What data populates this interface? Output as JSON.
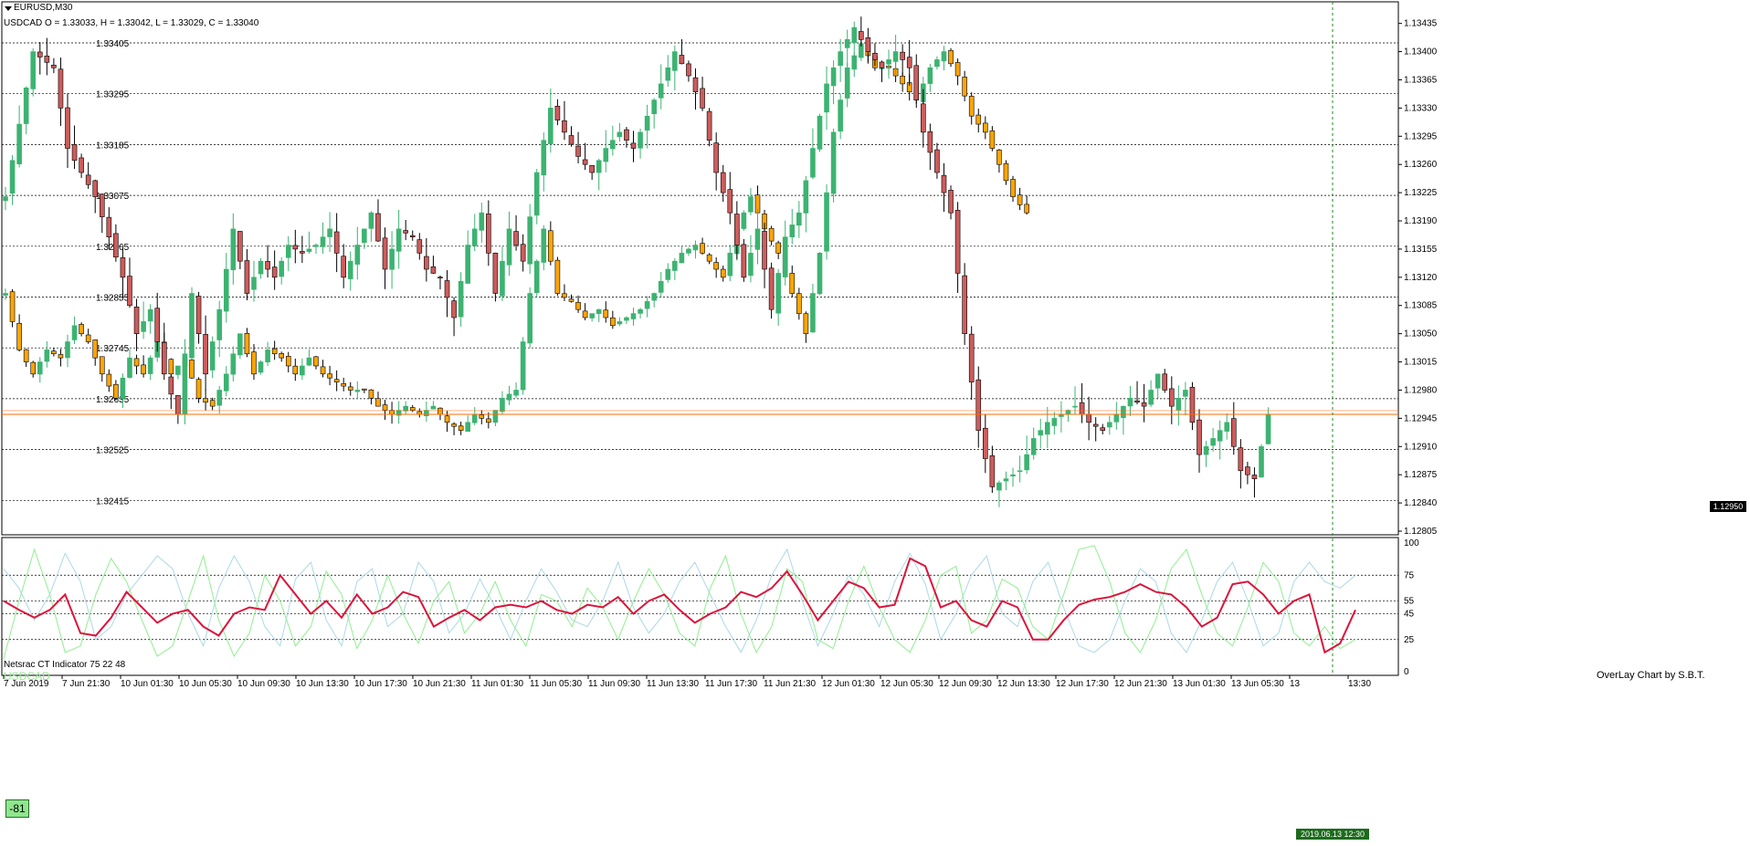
{
  "window": {
    "symbol_title": "EURUSD,M30",
    "overlay_info": "USDCAD O = 1.33033, H = 1.33042, L = 1.33029, C = 1.33040",
    "credit": "OverLay Chart by S.B.T.",
    "indicator_title": "Netsrac CT Indicator 75 22 48",
    "indicator_symbol": "USDCAD",
    "gauge_value": "-81",
    "current_price": "1.12950",
    "cursor_time": "2019.06.13 12:30"
  },
  "colors": {
    "bull": "#3cb371",
    "bear_body": "#cd5c5c",
    "overlay": "#ffa500",
    "grid": "#000000",
    "price_line": "#ff6a00",
    "cursor": "#228b22",
    "ct_line": "#dc143c",
    "green_line": "#90ee90",
    "blue_line": "#add8e6"
  },
  "chart_data": [
    {
      "type": "candlestick",
      "name": "EURUSD,M30",
      "right_axis_ticks": [
        "1.13435",
        "1.13400",
        "1.13365",
        "1.13330",
        "1.13295",
        "1.13260",
        "1.13225",
        "1.13190",
        "1.13155",
        "1.13120",
        "1.13085",
        "1.13050",
        "1.13015",
        "1.12980",
        "1.12945",
        "1.12910",
        "1.12875",
        "1.12840",
        "1.12805"
      ],
      "left_overlay_ticks": [
        "1.33405",
        "1.33295",
        "1.33185",
        "1.33075",
        "1.32965",
        "1.32855",
        "1.32745",
        "1.32635",
        "1.32525",
        "1.32415"
      ],
      "x_ticks": [
        "7 Jun 2019",
        "7 Jun 21:30",
        "10 Jun 01:30",
        "10 Jun 05:30",
        "10 Jun 09:30",
        "10 Jun 13:30",
        "10 Jun 17:30",
        "10 Jun 21:30",
        "11 Jun 01:30",
        "11 Jun 05:30",
        "11 Jun 09:30",
        "11 Jun 13:30",
        "11 Jun 17:30",
        "11 Jun 21:30",
        "12 Jun 01:30",
        "12 Jun 05:30",
        "12 Jun 09:30",
        "12 Jun 13:30",
        "12 Jun 17:30",
        "12 Jun 21:30",
        "13 Jun 01:30",
        "13 Jun 05:30",
        "13",
        "13:30"
      ],
      "ylim": [
        1.12805,
        1.13455
      ],
      "current_price": 1.1295,
      "close_path": [
        [
          0,
          1.1322
        ],
        [
          4,
          1.134
        ],
        [
          7,
          1.1338
        ],
        [
          9,
          1.1328
        ],
        [
          11,
          1.1325
        ],
        [
          13,
          1.1322
        ],
        [
          15,
          1.1317
        ],
        [
          17,
          1.1312
        ],
        [
          19,
          1.1305
        ],
        [
          21,
          1.1308
        ],
        [
          23,
          1.13
        ],
        [
          25,
          1.1295
        ],
        [
          27,
          1.131
        ],
        [
          29,
          1.13
        ],
        [
          31,
          1.1308
        ],
        [
          33,
          1.1318
        ],
        [
          35,
          1.131
        ],
        [
          37,
          1.1314
        ],
        [
          39,
          1.1312
        ],
        [
          41,
          1.1316
        ],
        [
          43,
          1.1315
        ],
        [
          45,
          1.1316
        ],
        [
          47,
          1.1318
        ],
        [
          49,
          1.1312
        ],
        [
          51,
          1.1316
        ],
        [
          53,
          1.132
        ],
        [
          55,
          1.1313
        ],
        [
          57,
          1.1318
        ],
        [
          59,
          1.1317
        ],
        [
          61,
          1.1313
        ],
        [
          63,
          1.1312
        ],
        [
          65,
          1.1307
        ],
        [
          67,
          1.1316
        ],
        [
          69,
          1.132
        ],
        [
          71,
          1.131
        ],
        [
          73,
          1.1318
        ],
        [
          75,
          1.1314
        ],
        [
          77,
          1.1325
        ],
        [
          79,
          1.1333
        ],
        [
          81,
          1.133
        ],
        [
          83,
          1.1327
        ],
        [
          85,
          1.1325
        ],
        [
          87,
          1.1328
        ],
        [
          89,
          1.133
        ],
        [
          91,
          1.1328
        ],
        [
          93,
          1.1332
        ],
        [
          95,
          1.1336
        ],
        [
          97,
          1.134
        ],
        [
          99,
          1.1337
        ],
        [
          101,
          1.1333
        ],
        [
          103,
          1.1325
        ],
        [
          105,
          1.132
        ],
        [
          107,
          1.1312
        ],
        [
          109,
          1.1318
        ],
        [
          111,
          1.1308
        ],
        [
          113,
          1.1317
        ],
        [
          115,
          1.132
        ],
        [
          117,
          1.1328
        ],
        [
          119,
          1.1336
        ],
        [
          121,
          1.134
        ],
        [
          123,
          1.1343
        ],
        [
          125,
          1.134
        ],
        [
          127,
          1.1338
        ],
        [
          129,
          1.134
        ],
        [
          131,
          1.1338
        ],
        [
          133,
          1.133
        ],
        [
          135,
          1.1325
        ],
        [
          137,
          1.132
        ],
        [
          139,
          1.1305
        ],
        [
          141,
          1.1293
        ],
        [
          143,
          1.1286
        ],
        [
          145,
          1.1287
        ],
        [
          147,
          1.1288
        ],
        [
          149,
          1.1292
        ],
        [
          151,
          1.1294
        ],
        [
          153,
          1.1295
        ],
        [
          155,
          1.1296
        ],
        [
          157,
          1.1294
        ],
        [
          159,
          1.1293
        ],
        [
          161,
          1.1295
        ],
        [
          163,
          1.1297
        ],
        [
          165,
          1.1296
        ],
        [
          167,
          1.13
        ],
        [
          169,
          1.1296
        ],
        [
          171,
          1.1298
        ],
        [
          173,
          1.129
        ],
        [
          175,
          1.1292
        ],
        [
          177,
          1.1294
        ],
        [
          179,
          1.1288
        ],
        [
          181,
          1.1287
        ],
        [
          183,
          1.1295
        ]
      ],
      "overlay_path": [
        [
          0,
          1.131
        ],
        [
          2,
          1.1303
        ],
        [
          4,
          1.13
        ],
        [
          6,
          1.1303
        ],
        [
          8,
          1.1302
        ],
        [
          10,
          1.1306
        ],
        [
          12,
          1.1304
        ],
        [
          14,
          1.13
        ],
        [
          16,
          1.1297
        ],
        [
          18,
          1.1302
        ],
        [
          20,
          1.13
        ],
        [
          22,
          1.1304
        ],
        [
          24,
          1.13
        ],
        [
          26,
          1.1302
        ],
        [
          28,
          1.1297
        ],
        [
          30,
          1.1296
        ],
        [
          32,
          1.13
        ],
        [
          34,
          1.1305
        ],
        [
          36,
          1.13
        ],
        [
          38,
          1.1303
        ],
        [
          40,
          1.1302
        ],
        [
          42,
          1.13
        ],
        [
          44,
          1.1302
        ],
        [
          46,
          1.13
        ],
        [
          48,
          1.1299
        ],
        [
          50,
          1.1298
        ],
        [
          52,
          1.1298
        ],
        [
          54,
          1.1296
        ],
        [
          56,
          1.1295
        ],
        [
          58,
          1.1296
        ],
        [
          60,
          1.1295
        ],
        [
          62,
          1.1296
        ],
        [
          64,
          1.1294
        ],
        [
          66,
          1.1293
        ],
        [
          68,
          1.1295
        ],
        [
          70,
          1.1294
        ],
        [
          72,
          1.1297
        ],
        [
          74,
          1.1298
        ],
        [
          76,
          1.131
        ],
        [
          78,
          1.1318
        ],
        [
          80,
          1.131
        ],
        [
          82,
          1.1309
        ],
        [
          84,
          1.1307
        ],
        [
          86,
          1.1308
        ],
        [
          88,
          1.1306
        ],
        [
          90,
          1.1307
        ],
        [
          92,
          1.1308
        ],
        [
          94,
          1.131
        ],
        [
          96,
          1.1313
        ],
        [
          98,
          1.1315
        ],
        [
          100,
          1.1316
        ],
        [
          102,
          1.1314
        ],
        [
          104,
          1.1312
        ],
        [
          106,
          1.1318
        ],
        [
          108,
          1.1322
        ],
        [
          110,
          1.1318
        ],
        [
          112,
          1.1315
        ],
        [
          114,
          1.131
        ],
        [
          116,
          1.1305
        ],
        [
          118,
          1.1315
        ],
        [
          120,
          1.133
        ],
        [
          122,
          1.1338
        ],
        [
          124,
          1.1341
        ],
        [
          126,
          1.1338
        ],
        [
          128,
          1.1338
        ],
        [
          130,
          1.1336
        ],
        [
          132,
          1.1334
        ],
        [
          134,
          1.1338
        ],
        [
          136,
          1.134
        ],
        [
          138,
          1.1337
        ],
        [
          140,
          1.1332
        ],
        [
          142,
          1.133
        ],
        [
          144,
          1.1326
        ],
        [
          146,
          1.1322
        ],
        [
          148,
          1.132
        ]
      ],
      "x_range": [
        0,
        200
      ]
    },
    {
      "type": "line",
      "name": "Netsrac CT Indicator 75 22 48",
      "right_axis_ticks": [
        "100",
        "75",
        "55",
        "45",
        "25",
        "0"
      ],
      "ylim": [
        0,
        100
      ],
      "levels": [
        75,
        55,
        45,
        25
      ],
      "series": [
        {
          "name": "USDCAD",
          "values": [
            55,
            48,
            42,
            48,
            60,
            30,
            28,
            42,
            62,
            50,
            38,
            45,
            48,
            35,
            28,
            45,
            50,
            48,
            75,
            60,
            45,
            55,
            42,
            60,
            45,
            50,
            62,
            58,
            35,
            42,
            48,
            40,
            50,
            52,
            50,
            55,
            48,
            45,
            52,
            50,
            58,
            45,
            55,
            60,
            48,
            38,
            45,
            50,
            62,
            58,
            65,
            78,
            60,
            40,
            55,
            70,
            65,
            50,
            52,
            88,
            82,
            50,
            55,
            40,
            35,
            55,
            50,
            25,
            25,
            40,
            52,
            56,
            58,
            62,
            68,
            62,
            60,
            50,
            35,
            42,
            68,
            70,
            60,
            45,
            55,
            60,
            15,
            22,
            48
          ]
        },
        {
          "name": "",
          "values": [
            10,
            55,
            95,
            60,
            15,
            20,
            60,
            88,
            70,
            40,
            12,
            20,
            55,
            90,
            40,
            12,
            30,
            75,
            55,
            20,
            35,
            78,
            60,
            18,
            40,
            75,
            45,
            22,
            55,
            70,
            30,
            45,
            70,
            40,
            20,
            60,
            55,
            35,
            65,
            50,
            25,
            55,
            80,
            60,
            30,
            20,
            65,
            90,
            45,
            15,
            35,
            80,
            70,
            25,
            18,
            55,
            82,
            50,
            25,
            15,
            40,
            75,
            82,
            30,
            40,
            72,
            65,
            35,
            25,
            60,
            95,
            98,
            70,
            30,
            15,
            40,
            80,
            95,
            60,
            30,
            20,
            50,
            85,
            70,
            30,
            20,
            35,
            18,
            25
          ]
        },
        {
          "name": "",
          "values": [
            80,
            65,
            40,
            60,
            92,
            70,
            25,
            35,
            60,
            75,
            90,
            80,
            45,
            20,
            65,
            90,
            70,
            35,
            20,
            72,
            85,
            40,
            20,
            70,
            80,
            35,
            45,
            85,
            70,
            30,
            45,
            72,
            50,
            25,
            55,
            80,
            62,
            40,
            35,
            55,
            85,
            50,
            30,
            45,
            70,
            85,
            60,
            35,
            15,
            40,
            75,
            95,
            55,
            20,
            45,
            75,
            60,
            35,
            70,
            92,
            68,
            25,
            45,
            75,
            90,
            45,
            35,
            70,
            85,
            50,
            20,
            15,
            25,
            55,
            80,
            70,
            30,
            15,
            40,
            70,
            85,
            55,
            20,
            30,
            70,
            85,
            70,
            65,
            75
          ]
        }
      ]
    }
  ]
}
